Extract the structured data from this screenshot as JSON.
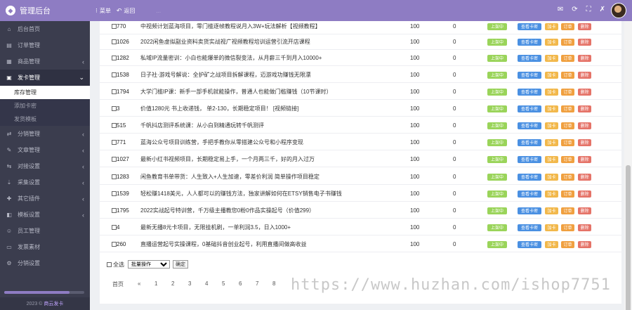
{
  "sidebar": {
    "brand": "管理后台",
    "items": [
      {
        "label": "后台首页",
        "icon": "home-icon",
        "glyph": "⌂"
      },
      {
        "label": "订单管理",
        "icon": "order-icon",
        "glyph": "▤"
      },
      {
        "label": "商品管理",
        "icon": "goods-icon",
        "glyph": "▦"
      },
      {
        "label": "发卡管理",
        "icon": "card-icon",
        "glyph": "▣"
      }
    ],
    "submenu": [
      "库存管理",
      "添加卡密",
      "发货模板"
    ],
    "items2": [
      {
        "label": "分销管理",
        "glyph": "⇄"
      },
      {
        "label": "文章管理",
        "glyph": "✎"
      },
      {
        "label": "对接设置",
        "glyph": "⇆"
      },
      {
        "label": "采集设置",
        "glyph": "⇣"
      },
      {
        "label": "其它插件",
        "glyph": "✚"
      },
      {
        "label": "模板设置",
        "glyph": "◧"
      },
      {
        "label": "员工管理",
        "glyph": "☺"
      },
      {
        "label": "发票素材",
        "glyph": "▭"
      },
      {
        "label": "分销设置",
        "glyph": "⚙"
      }
    ],
    "progress": 0.82,
    "footer_year": "2023 ©",
    "footer_link": "商云发卡"
  },
  "topbar": {
    "menu_label": "菜单",
    "back_label": "返回",
    "ghost_text": "...",
    "tools": [
      "✉",
      "⟳",
      "⛶",
      "✗"
    ]
  },
  "rows": [
    {
      "id": "770",
      "title": "中视频计划蓝海项目，零门槛逐帧教程说月入3W+玩法解析【视频教程】",
      "n1": "100",
      "n2": "0"
    },
    {
      "id": "1026",
      "title": "2022闲鱼虚拟副业资料卖货实战视广视频教程培训运营引流开店课程",
      "n1": "100",
      "n2": "0"
    },
    {
      "id": "1282",
      "title": "私域IP流量密训：小白也能爆单的微信裂变法，从月薪三千到月入10000+",
      "n1": "100",
      "n2": "0"
    },
    {
      "id": "1538",
      "title": "日子社·游戏号解说：全护矿之战项目拆解课程，迈游戏功赚钱无限漂",
      "n1": "100",
      "n2": "0"
    },
    {
      "id": "1794",
      "title": "大学门槛IP课：新手一部手机就能操作，普通人也能做门槛赚钱（10节课时）",
      "n1": "100",
      "n2": "0"
    },
    {
      "id": "3",
      "title": "价值1280元 书上收递钱，     单2-130，长期稳定项目！ [视频链接]",
      "n1": "100",
      "n2": "0"
    },
    {
      "id": "515",
      "title": "千帆抖店测评系统课：从小白到精通玩转千帆测评",
      "n1": "100",
      "n2": "0"
    },
    {
      "id": "771",
      "title": "蓝海公众号项目训练营，手把手教你从零搭建公众号和小程序变现",
      "n1": "100",
      "n2": "0"
    },
    {
      "id": "1027",
      "title": "最新小红书视频项目，长期稳定易上手，一个月两三千，好的月入过万",
      "n1": "100",
      "n2": "0"
    },
    {
      "id": "1283",
      "title": "闲鱼教育书单带货：人生致入+人生加速，零差价利润 简单操作项目稳定",
      "n1": "100",
      "n2": "0"
    },
    {
      "id": "1539",
      "title": "轻松赚1418美元，人人都可以的赚钱方法，独家讲解如何在ETSY销售电子书赚钱",
      "n1": "100",
      "n2": "0"
    },
    {
      "id": "1795",
      "title": "2022实战起号特训营，千万级主播教您0粉0作品实操起号（价值299）",
      "n1": "100",
      "n2": "0"
    },
    {
      "id": "4",
      "title": "最新无播8元卡项目，无限挂机刷，一单利润3.5，日入1000+",
      "n1": "100",
      "n2": "0"
    },
    {
      "id": "260",
      "title": "直播运营起号实操课程，0基础抖音创业起号，利用直播间做高收益",
      "n1": "100",
      "n2": "0"
    }
  ],
  "buttons": {
    "up": "上架中",
    "view": "查看卡密",
    "add": "加卡",
    "order": "订单",
    "del": "删除"
  },
  "batch": {
    "select_all": "全选",
    "action_selected": "批量操作",
    "confirm": "确定"
  },
  "pager": {
    "home": "首页",
    "prev": "«",
    "pages": [
      "1",
      "2",
      "3",
      "4",
      "5",
      "6",
      "7",
      "8"
    ]
  },
  "watermark": "https://www.huzhan.com/ishop7751",
  "colors": {
    "brand": "#8e7cc3",
    "sidebar": "#3b3d4e",
    "up_green": "#9ad45a",
    "view_blue": "#4a90e2",
    "add_orange": "#f2b84b",
    "order_orange": "#f0a040",
    "del_red": "#e57368"
  }
}
